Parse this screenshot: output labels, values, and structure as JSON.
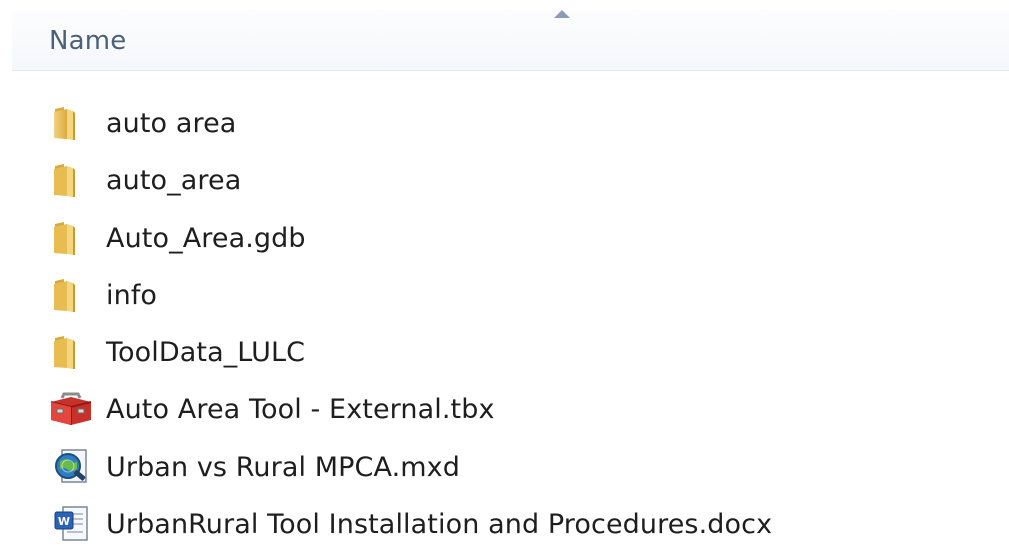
{
  "header": {
    "name_column_label": "Name"
  },
  "files": [
    {
      "name": "auto area",
      "icon": "folder-icon"
    },
    {
      "name": "auto_area",
      "icon": "folder-icon"
    },
    {
      "name": "Auto_Area.gdb",
      "icon": "folder-icon"
    },
    {
      "name": "info",
      "icon": "folder-icon"
    },
    {
      "name": "ToolData_LULC",
      "icon": "folder-icon"
    },
    {
      "name": "Auto Area Tool - External.tbx",
      "icon": "toolbox-icon"
    },
    {
      "name": "Urban vs Rural MPCA.mxd",
      "icon": "arcmap-document-icon"
    },
    {
      "name": "UrbanRural Tool Installation and Procedures.docx",
      "icon": "word-document-icon"
    }
  ],
  "colors": {
    "header_text": "#4c607a",
    "folder": "#e9c35a",
    "toolbox": "#c62f2a"
  }
}
